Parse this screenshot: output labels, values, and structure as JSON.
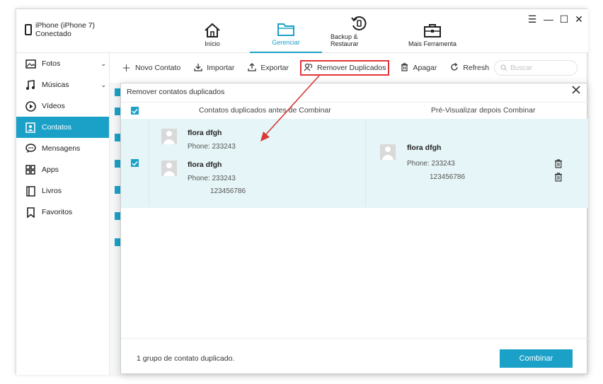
{
  "device": {
    "name": "iPhone (iPhone 7)",
    "status": "Conectado"
  },
  "nav": [
    {
      "label": "Início",
      "icon": "home-icon"
    },
    {
      "label": "Gerenciar",
      "icon": "folder-icon",
      "active": true
    },
    {
      "label": "Backup & Restaurar",
      "icon": "backup-restore-icon"
    },
    {
      "label": "Mais Ferramenta",
      "icon": "toolbox-icon"
    }
  ],
  "window_controls": [
    "menu-icon",
    "minimize-icon",
    "maximize-icon",
    "close-icon"
  ],
  "sidebar": {
    "items": [
      {
        "label": "Fotos",
        "icon": "photo-icon",
        "expandable": true
      },
      {
        "label": "Músicas",
        "icon": "music-icon",
        "expandable": true
      },
      {
        "label": "Vídeos",
        "icon": "play-icon"
      },
      {
        "label": "Contatos",
        "icon": "contact-icon",
        "active": true
      },
      {
        "label": "Mensagens",
        "icon": "message-icon"
      },
      {
        "label": "Apps",
        "icon": "apps-icon"
      },
      {
        "label": "Livros",
        "icon": "book-icon"
      },
      {
        "label": "Favoritos",
        "icon": "bookmark-icon"
      }
    ]
  },
  "toolbar": {
    "new_contact": "Novo Contato",
    "import": "Importar",
    "export": "Exportar",
    "remove_duplicates": "Remover Duplicados",
    "delete": "Apagar",
    "refresh": "Refresh",
    "search_placeholder": "Buscar"
  },
  "dialog": {
    "title": "Remover contatos duplicados",
    "col_before": "Contatos duplicados antes de Combinar",
    "col_after": "Pré-Visualizar depois Combinar",
    "before_contacts": [
      {
        "name": "flora dfgh",
        "phones": [
          "Phone: 233243"
        ]
      },
      {
        "name": "flora dfgh",
        "phones": [
          "Phone: 233243",
          "123456786"
        ]
      }
    ],
    "after_contact": {
      "name": "flora dfgh",
      "phones": [
        "Phone: 233243",
        "123456786"
      ]
    },
    "footer_text": "1 grupo de contato duplicado.",
    "combine_label": "Combinar"
  },
  "colors": {
    "accent": "#1ba1c8",
    "highlight_border": "#e0343a",
    "group_bg": "#e6f5f7"
  }
}
